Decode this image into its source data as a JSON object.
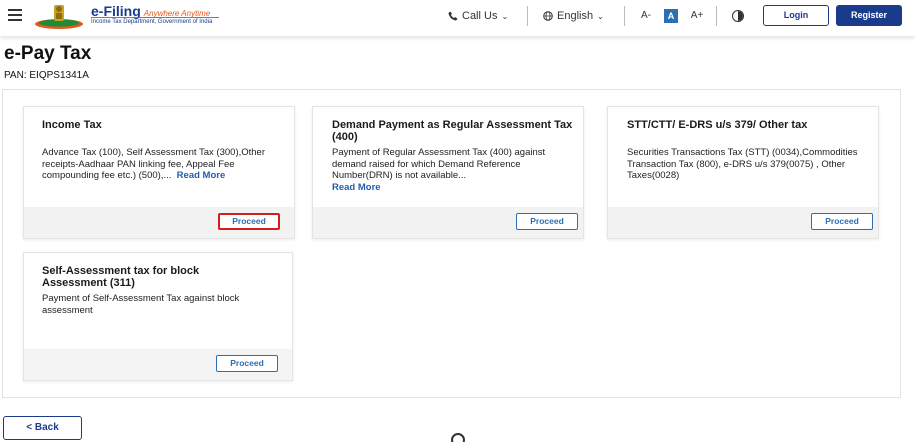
{
  "header": {
    "logo_title": "e-Filing",
    "logo_tagline": "Anywhere Anytime",
    "logo_subtitle": "Income Tax Department, Government of India",
    "call_us": "Call Us",
    "language": "English",
    "font_decrease": "A-",
    "font_normal": "A",
    "font_increase": "A+",
    "login": "Login",
    "register": "Register"
  },
  "page": {
    "title": "e-Pay Tax",
    "pan": "PAN: EIQPS1341A"
  },
  "cards": [
    {
      "title": "Income Tax",
      "description": "Advance Tax (100), Self Assessment Tax (300),Other receipts-Aadhaar PAN linking fee, Appeal Fee compounding fee etc.) (500),...",
      "read_more": "Read More",
      "button": "Proceed"
    },
    {
      "title": "Demand Payment as Regular Assessment Tax (400)",
      "description": "Payment of Regular Assessment Tax (400) against demand raised for which Demand Reference Number(DRN) is not available...",
      "read_more": "Read More",
      "button": "Proceed"
    },
    {
      "title": "STT/CTT/ E-DRS u/s 379/ Other tax",
      "description": "Securities Transactions Tax (STT) (0034),Commodities Transaction Tax (800), e-DRS u/s 379(0075) , Other Taxes(0028)",
      "button": "Proceed"
    },
    {
      "title": "Self-Assessment tax for block Assessment (311)",
      "description": "Payment of Self-Assessment Tax against block assessment",
      "button": "Proceed"
    }
  ],
  "back": "< Back",
  "colors": {
    "brand": "#1a3a8c",
    "accent": "#2c6fb3",
    "highlight": "#d11f1f"
  },
  "icons": [
    "hamburger-menu-icon",
    "emblem-logo-icon",
    "phone-icon",
    "globe-icon",
    "chevron-down-icon",
    "contrast-icon",
    "chat-icon"
  ]
}
